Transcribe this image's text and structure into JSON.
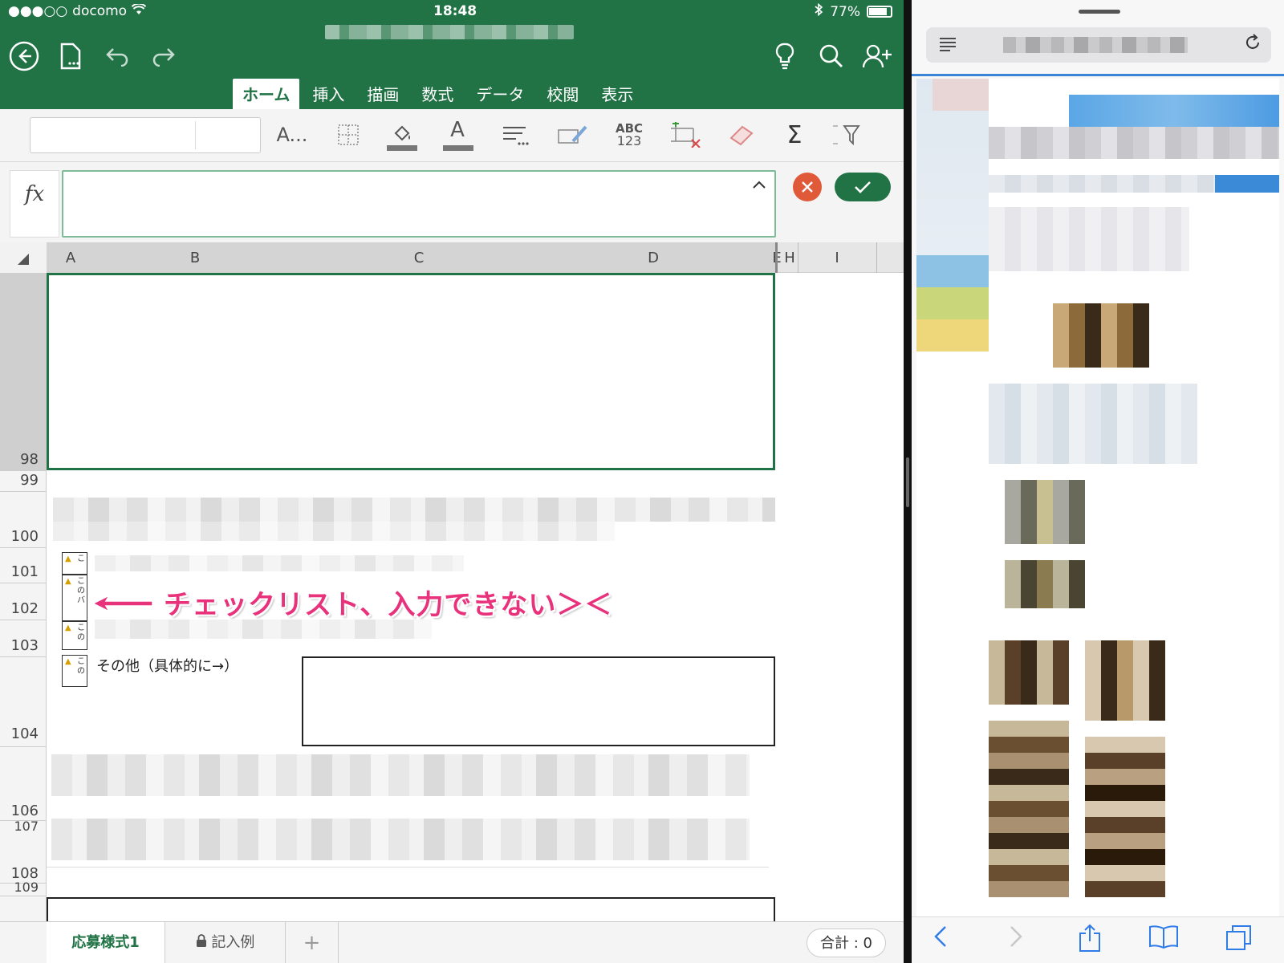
{
  "status_bar": {
    "carrier": "docomo",
    "signal": "●●●○○",
    "time": "18:48",
    "battery": "77%"
  },
  "excel": {
    "theme_color": "#217346",
    "tabs": [
      {
        "label": "ホーム",
        "active": true
      },
      {
        "label": "挿入",
        "active": false
      },
      {
        "label": "描画",
        "active": false
      },
      {
        "label": "数式",
        "active": false
      },
      {
        "label": "データ",
        "active": false
      },
      {
        "label": "校閲",
        "active": false
      },
      {
        "label": "表示",
        "active": false
      }
    ],
    "toolbar": {
      "font_label": "A...",
      "spell_label_top": "ABC",
      "spell_label_bottom": "123",
      "font_color_label": "A",
      "sum_symbol": "Σ"
    },
    "formula_bar": {
      "fx_label": "fx",
      "value": ""
    },
    "columns": [
      "A",
      "B",
      "C",
      "D",
      "E",
      "H",
      "I"
    ],
    "rows": [
      "98",
      "99",
      "100",
      "101",
      "102",
      "103",
      "104",
      "106",
      "107",
      "108",
      "109"
    ],
    "cells": {
      "other_label": "その他（具体的に→）",
      "check_char_top": "こ",
      "check_char_mid": "の",
      "check_char_b": "バ"
    },
    "annotation": {
      "text": "チェックリスト、入力できない＞＜",
      "color": "#e8327c"
    },
    "sheet_tabs": [
      {
        "label": "応募様式1",
        "active": true,
        "locked": false
      },
      {
        "label": "記入例",
        "active": false,
        "locked": true
      }
    ],
    "add_sheet": "+",
    "summary": "合計 : 0"
  },
  "safari": {
    "accent": "#2f7ce8"
  }
}
